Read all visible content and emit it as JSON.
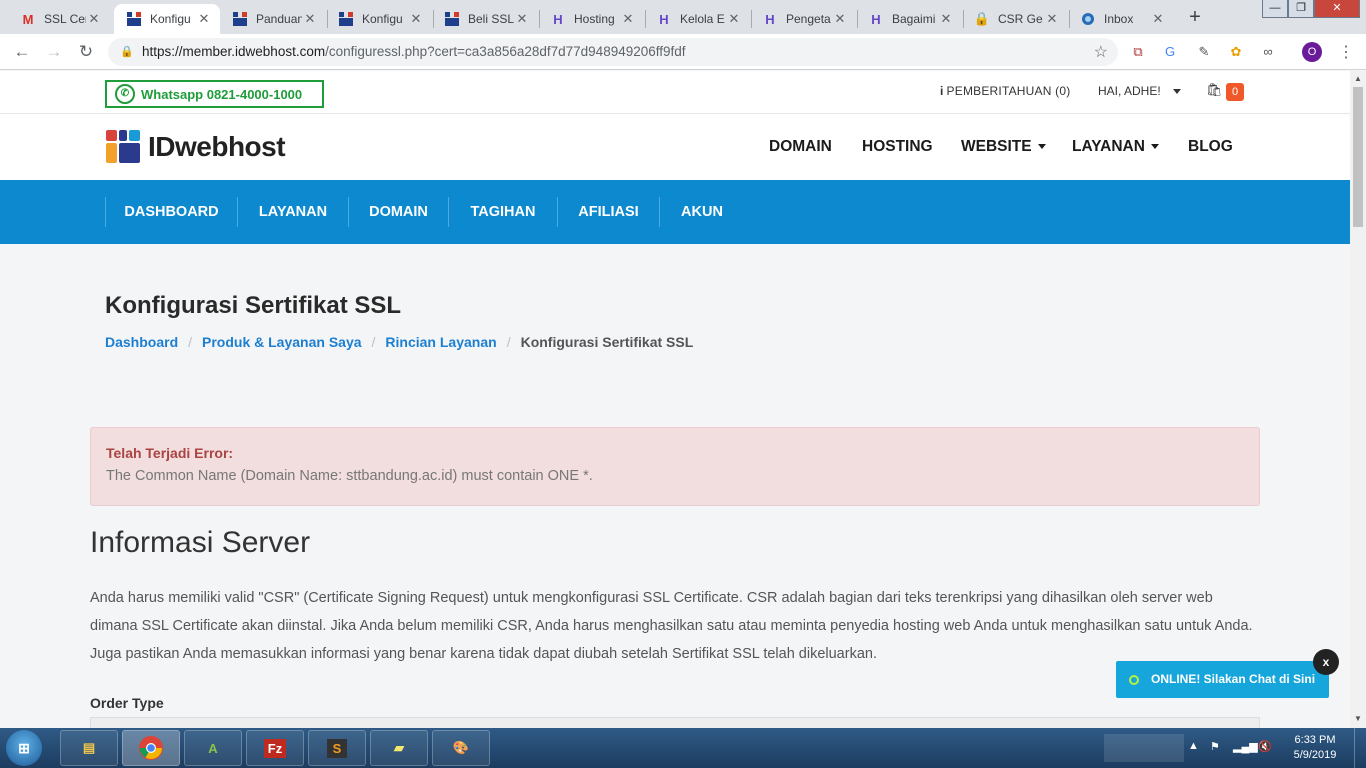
{
  "browser": {
    "tabs": [
      {
        "label": "SSL Cer",
        "icon": "gmail-icon"
      },
      {
        "label": "Konfigu",
        "icon": "idwebhost-icon",
        "active": true
      },
      {
        "label": "Panduan",
        "icon": "idwebhost-icon"
      },
      {
        "label": "Konfigu",
        "icon": "idwebhost-icon"
      },
      {
        "label": "Beli SSL",
        "icon": "idwebhost-icon"
      },
      {
        "label": "Hosting",
        "icon": "hostinger-icon"
      },
      {
        "label": "Kelola E",
        "icon": "hostinger-icon"
      },
      {
        "label": "Pengeta",
        "icon": "hostinger-icon"
      },
      {
        "label": "Bagaimi",
        "icon": "hostinger-icon"
      },
      {
        "label": "CSR Ge",
        "icon": "lock-icon"
      },
      {
        "label": "Inbox",
        "icon": "thunderbird-icon"
      }
    ],
    "url_host": "https://member.idwebhost.com",
    "url_rest": "/configuressl.php?cert=ca3a856a28df7d77d948949206ff9fdf",
    "profile_initial": "O"
  },
  "topbar": {
    "whatsapp": "Whatsapp 0821-4000-1000",
    "notifications": "PEMBERITAHUAN (0)",
    "greeting": "HAI, ADHE!",
    "cart_count": "0"
  },
  "header": {
    "logo_text": "IDwebhost",
    "nav": [
      "DOMAIN",
      "HOSTING",
      "WEBSITE",
      "LAYANAN",
      "BLOG"
    ]
  },
  "subnav": [
    "DASHBOARD",
    "LAYANAN",
    "DOMAIN",
    "TAGIHAN",
    "AFILIASI",
    "AKUN"
  ],
  "page": {
    "title": "Konfigurasi Sertifikat SSL",
    "breadcrumbs": [
      "Dashboard",
      "Produk & Layanan Saya",
      "Rincian Layanan",
      "Konfigurasi Sertifikat SSL"
    ],
    "alert_title": "Telah Terjadi Error:",
    "alert_message": "The Common Name (Domain Name: sttbandung.ac.id) must contain ONE *.",
    "section_title": "Informasi Server",
    "paragraph": "Anda harus memiliki valid \"CSR\" (Certificate Signing Request) untuk mengkonfigurasi SSL Certificate. CSR adalah bagian dari teks terenkripsi yang dihasilkan oleh server web dimana SSL Certificate akan diinstal. Jika Anda belum memiliki CSR, Anda harus menghasilkan satu atau meminta penyedia hosting web Anda untuk menghasilkan satu untuk Anda. Juga pastikan Anda memasukkan informasi yang benar karena tidak dapat diubah setelah Sertifikat SSL telah dikeluarkan.",
    "order_type_label": "Order Type"
  },
  "chat": {
    "label": "ONLINE! Silakan Chat di Sini",
    "close": "x"
  },
  "taskbar": {
    "time": "6:33 PM",
    "date": "5/9/2019"
  },
  "colors": {
    "brand_blue": "#0c89cf",
    "link_blue": "#1d7fd0",
    "alert_bg": "#f2dede",
    "alert_title": "#a94442",
    "whatsapp_green": "#1f9d3a",
    "cart_badge": "#f0582a",
    "chat_bg": "#17a6dc"
  }
}
